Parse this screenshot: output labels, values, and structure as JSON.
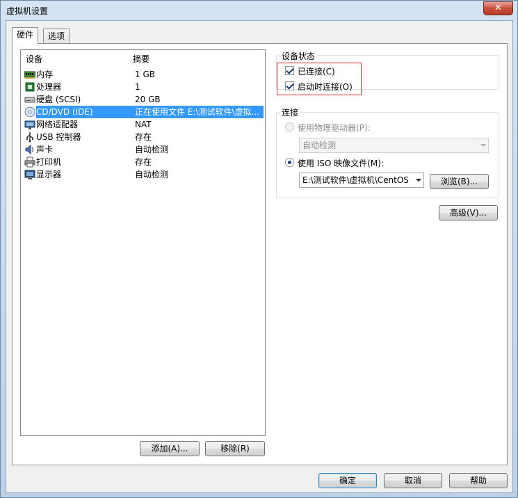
{
  "window": {
    "title": "虚拟机设置",
    "close_label": "✕"
  },
  "tabs": [
    {
      "label": "硬件",
      "active": true
    },
    {
      "label": "选项",
      "active": false
    }
  ],
  "device_list": {
    "headers": {
      "device": "设备",
      "summary": "摘要"
    },
    "rows": [
      {
        "icon": "memory-icon",
        "label": "内存",
        "summary": "1 GB"
      },
      {
        "icon": "processor-icon",
        "label": "处理器",
        "summary": "1"
      },
      {
        "icon": "hard-disk-icon",
        "label": "硬盘 (SCSI)",
        "summary": "20 GB"
      },
      {
        "icon": "cd-dvd-icon",
        "label": "CD/DVD (IDE)",
        "summary": "正在使用文件 E:\\测试软件\\虚拟...",
        "selected": true
      },
      {
        "icon": "network-adapter-icon",
        "label": "网络适配器",
        "summary": "NAT"
      },
      {
        "icon": "usb-icon",
        "label": "USB 控制器",
        "summary": "存在"
      },
      {
        "icon": "sound-card-icon",
        "label": "声卡",
        "summary": "自动检测"
      },
      {
        "icon": "printer-icon",
        "label": "打印机",
        "summary": "存在"
      },
      {
        "icon": "display-icon",
        "label": "显示器",
        "summary": "自动检测"
      }
    ]
  },
  "list_buttons": {
    "add": "添加(A)...",
    "remove": "移除(R)"
  },
  "device_status": {
    "title": "设备状态",
    "connected": {
      "label": "已连接(C)",
      "checked": true
    },
    "connect_at_power_on": {
      "label": "启动时连接(O)",
      "checked": true
    }
  },
  "connection": {
    "title": "连接",
    "physical_drive": {
      "label": "使用物理驱动器(P):",
      "selected": false
    },
    "physical_drive_value": "自动检测",
    "iso_image": {
      "label": "使用 ISO 映像文件(M):",
      "selected": true
    },
    "iso_path": "E:\\测试软件\\虚拟机\\CentOS",
    "browse": "浏览(B)..."
  },
  "advanced_button": "高级(V)...",
  "footer": {
    "ok": "确定",
    "cancel": "取消",
    "help": "帮助"
  }
}
